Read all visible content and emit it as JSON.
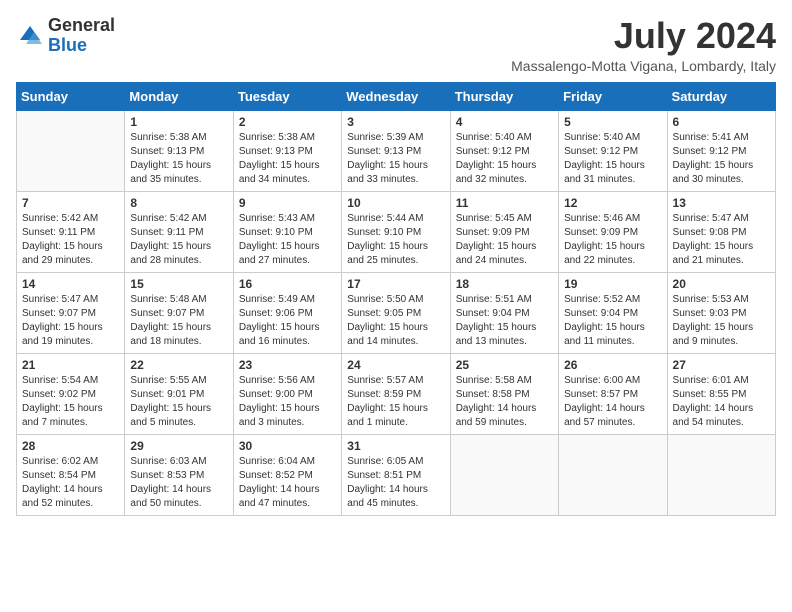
{
  "logo": {
    "general": "General",
    "blue": "Blue"
  },
  "header": {
    "month": "July 2024",
    "location": "Massalengo-Motta Vigana, Lombardy, Italy"
  },
  "weekdays": [
    "Sunday",
    "Monday",
    "Tuesday",
    "Wednesday",
    "Thursday",
    "Friday",
    "Saturday"
  ],
  "weeks": [
    [
      {
        "day": "",
        "info": ""
      },
      {
        "day": "1",
        "info": "Sunrise: 5:38 AM\nSunset: 9:13 PM\nDaylight: 15 hours\nand 35 minutes."
      },
      {
        "day": "2",
        "info": "Sunrise: 5:38 AM\nSunset: 9:13 PM\nDaylight: 15 hours\nand 34 minutes."
      },
      {
        "day": "3",
        "info": "Sunrise: 5:39 AM\nSunset: 9:13 PM\nDaylight: 15 hours\nand 33 minutes."
      },
      {
        "day": "4",
        "info": "Sunrise: 5:40 AM\nSunset: 9:12 PM\nDaylight: 15 hours\nand 32 minutes."
      },
      {
        "day": "5",
        "info": "Sunrise: 5:40 AM\nSunset: 9:12 PM\nDaylight: 15 hours\nand 31 minutes."
      },
      {
        "day": "6",
        "info": "Sunrise: 5:41 AM\nSunset: 9:12 PM\nDaylight: 15 hours\nand 30 minutes."
      }
    ],
    [
      {
        "day": "7",
        "info": "Sunrise: 5:42 AM\nSunset: 9:11 PM\nDaylight: 15 hours\nand 29 minutes."
      },
      {
        "day": "8",
        "info": "Sunrise: 5:42 AM\nSunset: 9:11 PM\nDaylight: 15 hours\nand 28 minutes."
      },
      {
        "day": "9",
        "info": "Sunrise: 5:43 AM\nSunset: 9:10 PM\nDaylight: 15 hours\nand 27 minutes."
      },
      {
        "day": "10",
        "info": "Sunrise: 5:44 AM\nSunset: 9:10 PM\nDaylight: 15 hours\nand 25 minutes."
      },
      {
        "day": "11",
        "info": "Sunrise: 5:45 AM\nSunset: 9:09 PM\nDaylight: 15 hours\nand 24 minutes."
      },
      {
        "day": "12",
        "info": "Sunrise: 5:46 AM\nSunset: 9:09 PM\nDaylight: 15 hours\nand 22 minutes."
      },
      {
        "day": "13",
        "info": "Sunrise: 5:47 AM\nSunset: 9:08 PM\nDaylight: 15 hours\nand 21 minutes."
      }
    ],
    [
      {
        "day": "14",
        "info": "Sunrise: 5:47 AM\nSunset: 9:07 PM\nDaylight: 15 hours\nand 19 minutes."
      },
      {
        "day": "15",
        "info": "Sunrise: 5:48 AM\nSunset: 9:07 PM\nDaylight: 15 hours\nand 18 minutes."
      },
      {
        "day": "16",
        "info": "Sunrise: 5:49 AM\nSunset: 9:06 PM\nDaylight: 15 hours\nand 16 minutes."
      },
      {
        "day": "17",
        "info": "Sunrise: 5:50 AM\nSunset: 9:05 PM\nDaylight: 15 hours\nand 14 minutes."
      },
      {
        "day": "18",
        "info": "Sunrise: 5:51 AM\nSunset: 9:04 PM\nDaylight: 15 hours\nand 13 minutes."
      },
      {
        "day": "19",
        "info": "Sunrise: 5:52 AM\nSunset: 9:04 PM\nDaylight: 15 hours\nand 11 minutes."
      },
      {
        "day": "20",
        "info": "Sunrise: 5:53 AM\nSunset: 9:03 PM\nDaylight: 15 hours\nand 9 minutes."
      }
    ],
    [
      {
        "day": "21",
        "info": "Sunrise: 5:54 AM\nSunset: 9:02 PM\nDaylight: 15 hours\nand 7 minutes."
      },
      {
        "day": "22",
        "info": "Sunrise: 5:55 AM\nSunset: 9:01 PM\nDaylight: 15 hours\nand 5 minutes."
      },
      {
        "day": "23",
        "info": "Sunrise: 5:56 AM\nSunset: 9:00 PM\nDaylight: 15 hours\nand 3 minutes."
      },
      {
        "day": "24",
        "info": "Sunrise: 5:57 AM\nSunset: 8:59 PM\nDaylight: 15 hours\nand 1 minute."
      },
      {
        "day": "25",
        "info": "Sunrise: 5:58 AM\nSunset: 8:58 PM\nDaylight: 14 hours\nand 59 minutes."
      },
      {
        "day": "26",
        "info": "Sunrise: 6:00 AM\nSunset: 8:57 PM\nDaylight: 14 hours\nand 57 minutes."
      },
      {
        "day": "27",
        "info": "Sunrise: 6:01 AM\nSunset: 8:55 PM\nDaylight: 14 hours\nand 54 minutes."
      }
    ],
    [
      {
        "day": "28",
        "info": "Sunrise: 6:02 AM\nSunset: 8:54 PM\nDaylight: 14 hours\nand 52 minutes."
      },
      {
        "day": "29",
        "info": "Sunrise: 6:03 AM\nSunset: 8:53 PM\nDaylight: 14 hours\nand 50 minutes."
      },
      {
        "day": "30",
        "info": "Sunrise: 6:04 AM\nSunset: 8:52 PM\nDaylight: 14 hours\nand 47 minutes."
      },
      {
        "day": "31",
        "info": "Sunrise: 6:05 AM\nSunset: 8:51 PM\nDaylight: 14 hours\nand 45 minutes."
      },
      {
        "day": "",
        "info": ""
      },
      {
        "day": "",
        "info": ""
      },
      {
        "day": "",
        "info": ""
      }
    ]
  ]
}
